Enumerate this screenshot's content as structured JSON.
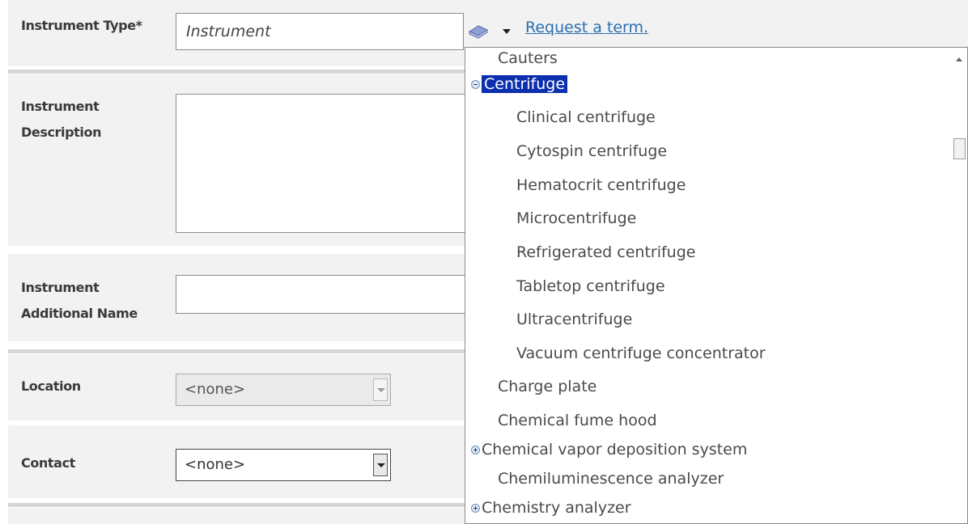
{
  "form": {
    "instrument_type": {
      "label": "Instrument Type*",
      "value": "Instrument"
    },
    "instrument_description": {
      "label_line1": "Instrument",
      "label_line2": "Description",
      "value": ""
    },
    "instrument_additional_name": {
      "label_line1": "Instrument",
      "label_line2": "Additional Name",
      "value": ""
    },
    "location": {
      "label": "Location",
      "value": "<none>"
    },
    "contact": {
      "label": "Contact",
      "value": "<none>"
    }
  },
  "tools": {
    "request_link": "Request a term."
  },
  "dropdown": {
    "items": [
      {
        "label": "Cauters",
        "level": 1,
        "toggle": "",
        "selected": false
      },
      {
        "label": "Centrifuge",
        "level": 0,
        "toggle": "minus",
        "selected": true
      },
      {
        "label": "Clinical centrifuge",
        "level": 2,
        "toggle": "",
        "selected": false
      },
      {
        "label": "Cytospin centrifuge",
        "level": 2,
        "toggle": "",
        "selected": false
      },
      {
        "label": "Hematocrit centrifuge",
        "level": 2,
        "toggle": "",
        "selected": false
      },
      {
        "label": "Microcentrifuge",
        "level": 2,
        "toggle": "",
        "selected": false
      },
      {
        "label": "Refrigerated centrifuge",
        "level": 2,
        "toggle": "",
        "selected": false
      },
      {
        "label": "Tabletop centrifuge",
        "level": 2,
        "toggle": "",
        "selected": false
      },
      {
        "label": "Ultracentrifuge",
        "level": 2,
        "toggle": "",
        "selected": false
      },
      {
        "label": "Vacuum centrifuge concentrator",
        "level": 2,
        "toggle": "",
        "selected": false
      },
      {
        "label": "Charge plate",
        "level": 1,
        "toggle": "",
        "selected": false
      },
      {
        "label": "Chemical fume hood",
        "level": 1,
        "toggle": "",
        "selected": false
      },
      {
        "label": "Chemical vapor deposition system",
        "level": 0,
        "toggle": "plus",
        "selected": false
      },
      {
        "label": "Chemiluminescence analyzer",
        "level": 1,
        "toggle": "",
        "selected": false
      },
      {
        "label": "Chemistry analyzer",
        "level": 0,
        "toggle": "plus",
        "selected": false
      }
    ]
  },
  "colors": {
    "selected_bg": "#0b2fae",
    "link": "#2b6fae",
    "row_bg": "#f2f2f2"
  }
}
